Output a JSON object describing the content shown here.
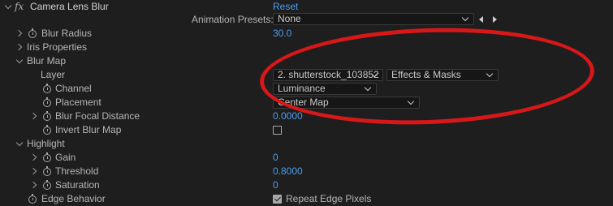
{
  "effect": {
    "name": "Camera Lens Blur",
    "fx_label": "fx",
    "reset_label": "Reset"
  },
  "presets": {
    "label": "Animation Presets:",
    "value": "None"
  },
  "properties": {
    "blur_radius": {
      "label": "Blur Radius",
      "value": "30.0"
    },
    "iris": {
      "label": "Iris Properties"
    },
    "blur_map": {
      "label": "Blur Map"
    },
    "layer": {
      "label": "Layer",
      "value": "2. shutterstock_103852",
      "source": "Effects & Masks"
    },
    "channel": {
      "label": "Channel",
      "value": "Luminance"
    },
    "placement": {
      "label": "Placement",
      "value": "Center Map"
    },
    "blur_focal_distance": {
      "label": "Blur Focal Distance",
      "value": "0.0000"
    },
    "invert_blur_map": {
      "label": "Invert Blur Map"
    },
    "highlight": {
      "label": "Highlight"
    },
    "gain": {
      "label": "Gain",
      "value": "0"
    },
    "threshold": {
      "label": "Threshold",
      "value": "0.8000"
    },
    "saturation": {
      "label": "Saturation",
      "value": "0"
    },
    "edge_behavior": {
      "label": "Edge Behavior",
      "value": "Repeat Edge Pixels"
    }
  },
  "colors": {
    "value_blue": "#4b9cf0",
    "annotation_red": "#d81818",
    "panel_bg": "#1e1e1e"
  }
}
